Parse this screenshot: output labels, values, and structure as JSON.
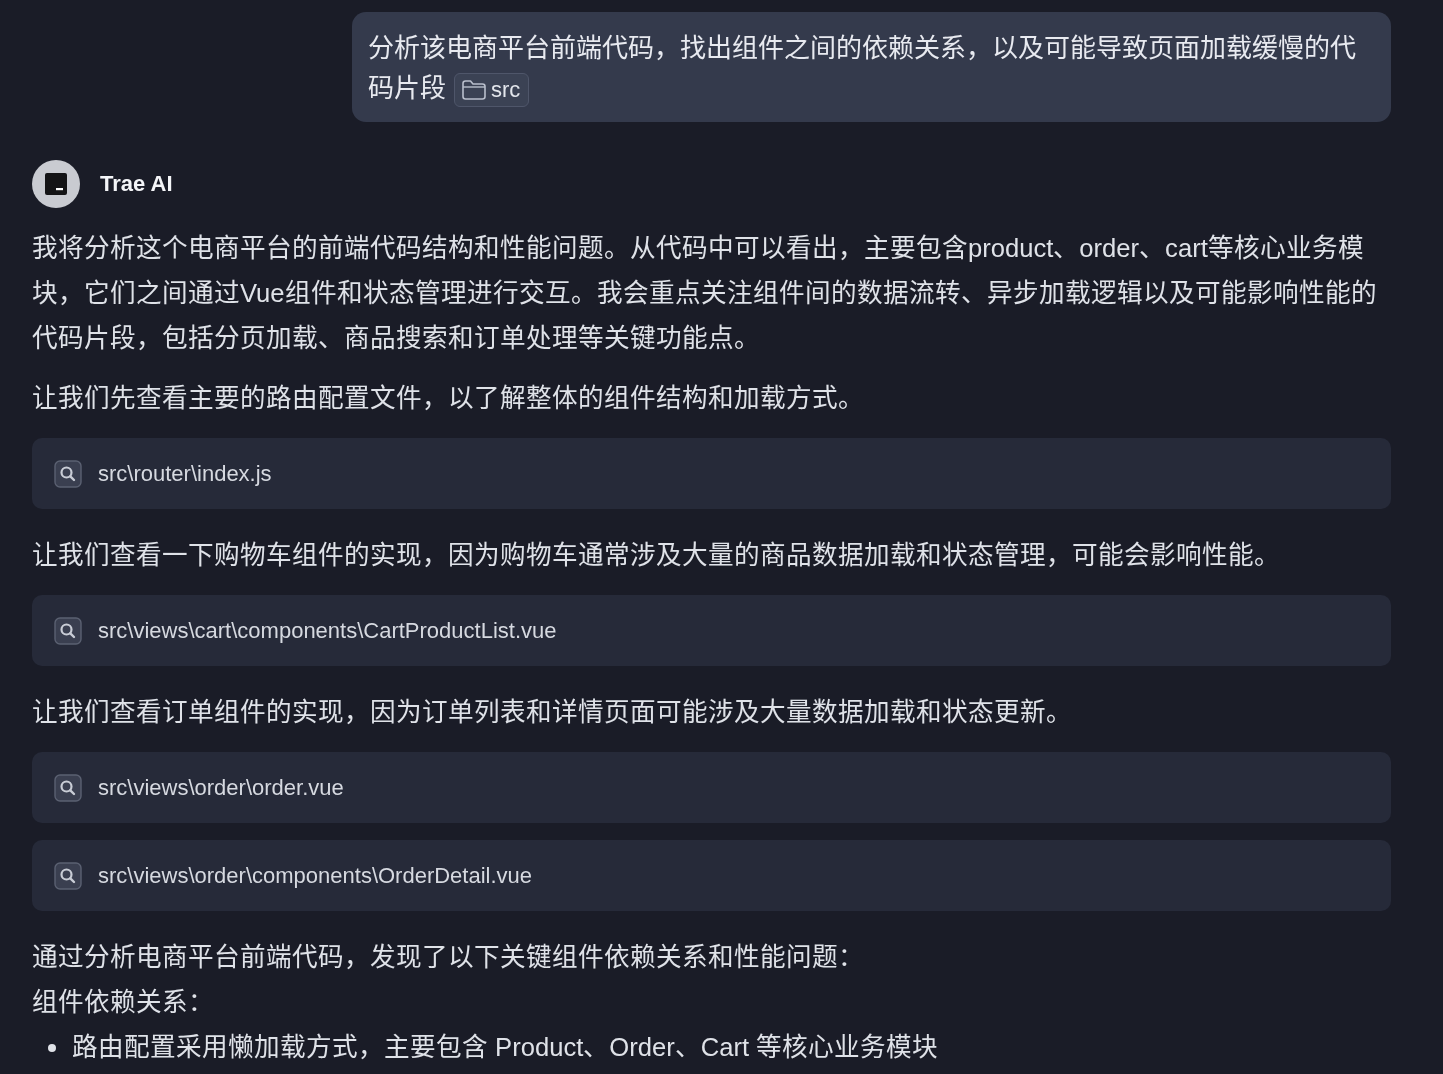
{
  "user_message": {
    "text": "分析该电商平台前端代码，找出组件之间的依赖关系，以及可能导致页面加载缓慢的代码片段",
    "attachment": {
      "label": "src"
    }
  },
  "assistant": {
    "name": "Trae AI",
    "blocks": [
      {
        "kind": "text",
        "text": "我将分析这个电商平台的前端代码结构和性能问题。从代码中可以看出，主要包含product、order、cart等核心业务模块，它们之间通过Vue组件和状态管理进行交互。我会重点关注组件间的数据流转、异步加载逻辑以及可能影响性能的代码片段，包括分页加载、商品搜索和订单处理等关键功能点。"
      },
      {
        "kind": "text",
        "text": "让我们先查看主要的路由配置文件，以了解整体的组件结构和加载方式。"
      },
      {
        "kind": "file",
        "path": "src\\router\\index.js"
      },
      {
        "kind": "text",
        "text": "让我们查看一下购物车组件的实现，因为购物车通常涉及大量的商品数据加载和状态管理，可能会影响性能。"
      },
      {
        "kind": "file",
        "path": "src\\views\\cart\\components\\CartProductList.vue"
      },
      {
        "kind": "text",
        "text": "让我们查看订单组件的实现，因为订单列表和详情页面可能涉及大量数据加载和状态更新。"
      },
      {
        "kind": "file",
        "path": "src\\views\\order\\order.vue"
      },
      {
        "kind": "file",
        "path": "src\\views\\order\\components\\OrderDetail.vue"
      },
      {
        "kind": "text",
        "text": "通过分析电商平台前端代码，发现了以下关键组件依赖关系和性能问题："
      },
      {
        "kind": "heading",
        "text": "组件依赖关系："
      },
      {
        "kind": "list",
        "items": [
          "路由配置采用懒加载方式，主要包含 Product、Order、Cart 等核心业务模块"
        ]
      }
    ]
  }
}
